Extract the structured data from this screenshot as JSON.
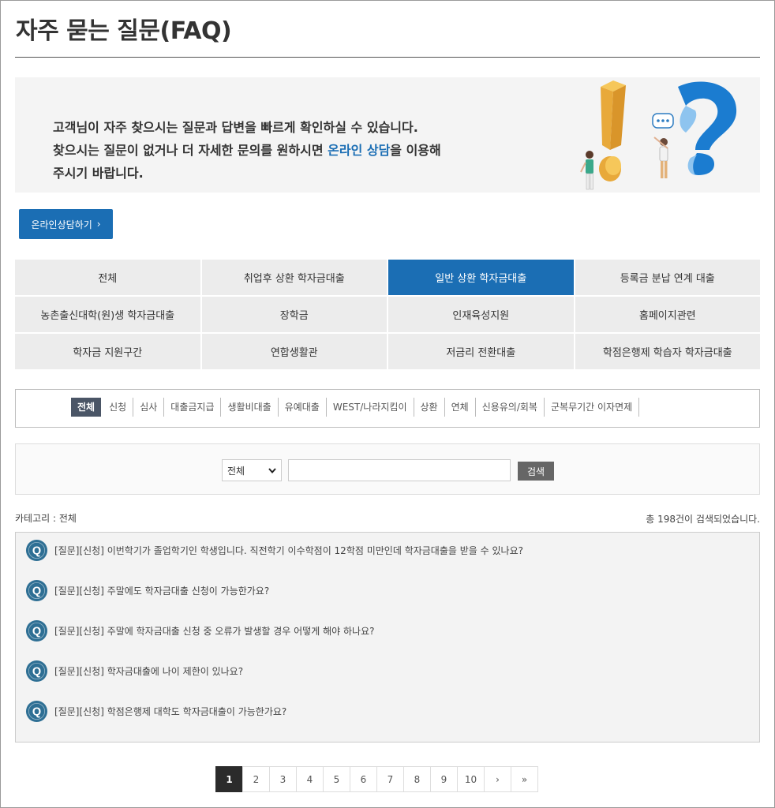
{
  "page": {
    "title": "자주 묻는 질문(FAQ)"
  },
  "banner": {
    "line1": "고객님이 자주 찾으시는 질문과 답변을 빠르게 확인하실 수 있습니다.",
    "line2_pre": "찾으시는 질문이 없거나 더 자세한 문의를 원하시면 ",
    "line2_link": "온라인 상담",
    "line2_post": "을 이용해",
    "line3": "주시기 바랍니다."
  },
  "consult_button": {
    "label": "온라인상담하기",
    "arrow": "›"
  },
  "categories": [
    {
      "label": "전체"
    },
    {
      "label": "취업후 상환 학자금대출"
    },
    {
      "label": "일반 상환 학자금대출"
    },
    {
      "label": "등록금 분납 연계 대출"
    },
    {
      "label": "농촌출신대학(원)생 학자금대출"
    },
    {
      "label": "장학금"
    },
    {
      "label": "인재육성지원"
    },
    {
      "label": "홈페이지관련"
    },
    {
      "label": "학자금 지원구간"
    },
    {
      "label": "연합생활관"
    },
    {
      "label": "저금리 전환대출"
    },
    {
      "label": "학점은행제 학습자 학자금대출"
    }
  ],
  "active_category": "일반 상환 학자금대출",
  "sub_tabs": [
    {
      "label": "전체"
    },
    {
      "label": "신청"
    },
    {
      "label": "심사"
    },
    {
      "label": "대출금지급"
    },
    {
      "label": "생활비대출"
    },
    {
      "label": "유예대출"
    },
    {
      "label": "WEST/나라지킴이"
    },
    {
      "label": "상환"
    },
    {
      "label": "연체"
    },
    {
      "label": "신용유의/회복"
    },
    {
      "label": "군복무기간 이자면제"
    }
  ],
  "active_sub_tab": "전체",
  "search": {
    "select_value": "전체",
    "input_value": "",
    "button_label": "검색"
  },
  "category_label": "카테고리 : 전체",
  "result_count": "총 198건이 검색되었습니다.",
  "faq_items": [
    {
      "text": "[질문][신청] 이번학기가 졸업학기인 학생입니다. 직전학기 이수학점이 12학점 미만인데 학자금대출을 받을 수 있나요?"
    },
    {
      "text": "[질문][신청] 주말에도 학자금대출 신청이 가능한가요?"
    },
    {
      "text": "[질문][신청] 주말에 학자금대출 신청 중 오류가 발생할 경우 어떻게 해야 하나요?"
    },
    {
      "text": "[질문][신청] 학자금대출에 나이 제한이 있나요?"
    },
    {
      "text": "[질문][신청] 학점은행제 대학도 학자금대출이 가능한가요?"
    }
  ],
  "q_icon_letter": "Q",
  "pagination": {
    "pages": [
      "1",
      "2",
      "3",
      "4",
      "5",
      "6",
      "7",
      "8",
      "9",
      "10"
    ],
    "current": "1",
    "next": "›",
    "last": "»"
  },
  "colors": {
    "accent": "#1b6eb4",
    "sub_tab_active": "#4a5566",
    "q_icon": "#2e6f94"
  }
}
